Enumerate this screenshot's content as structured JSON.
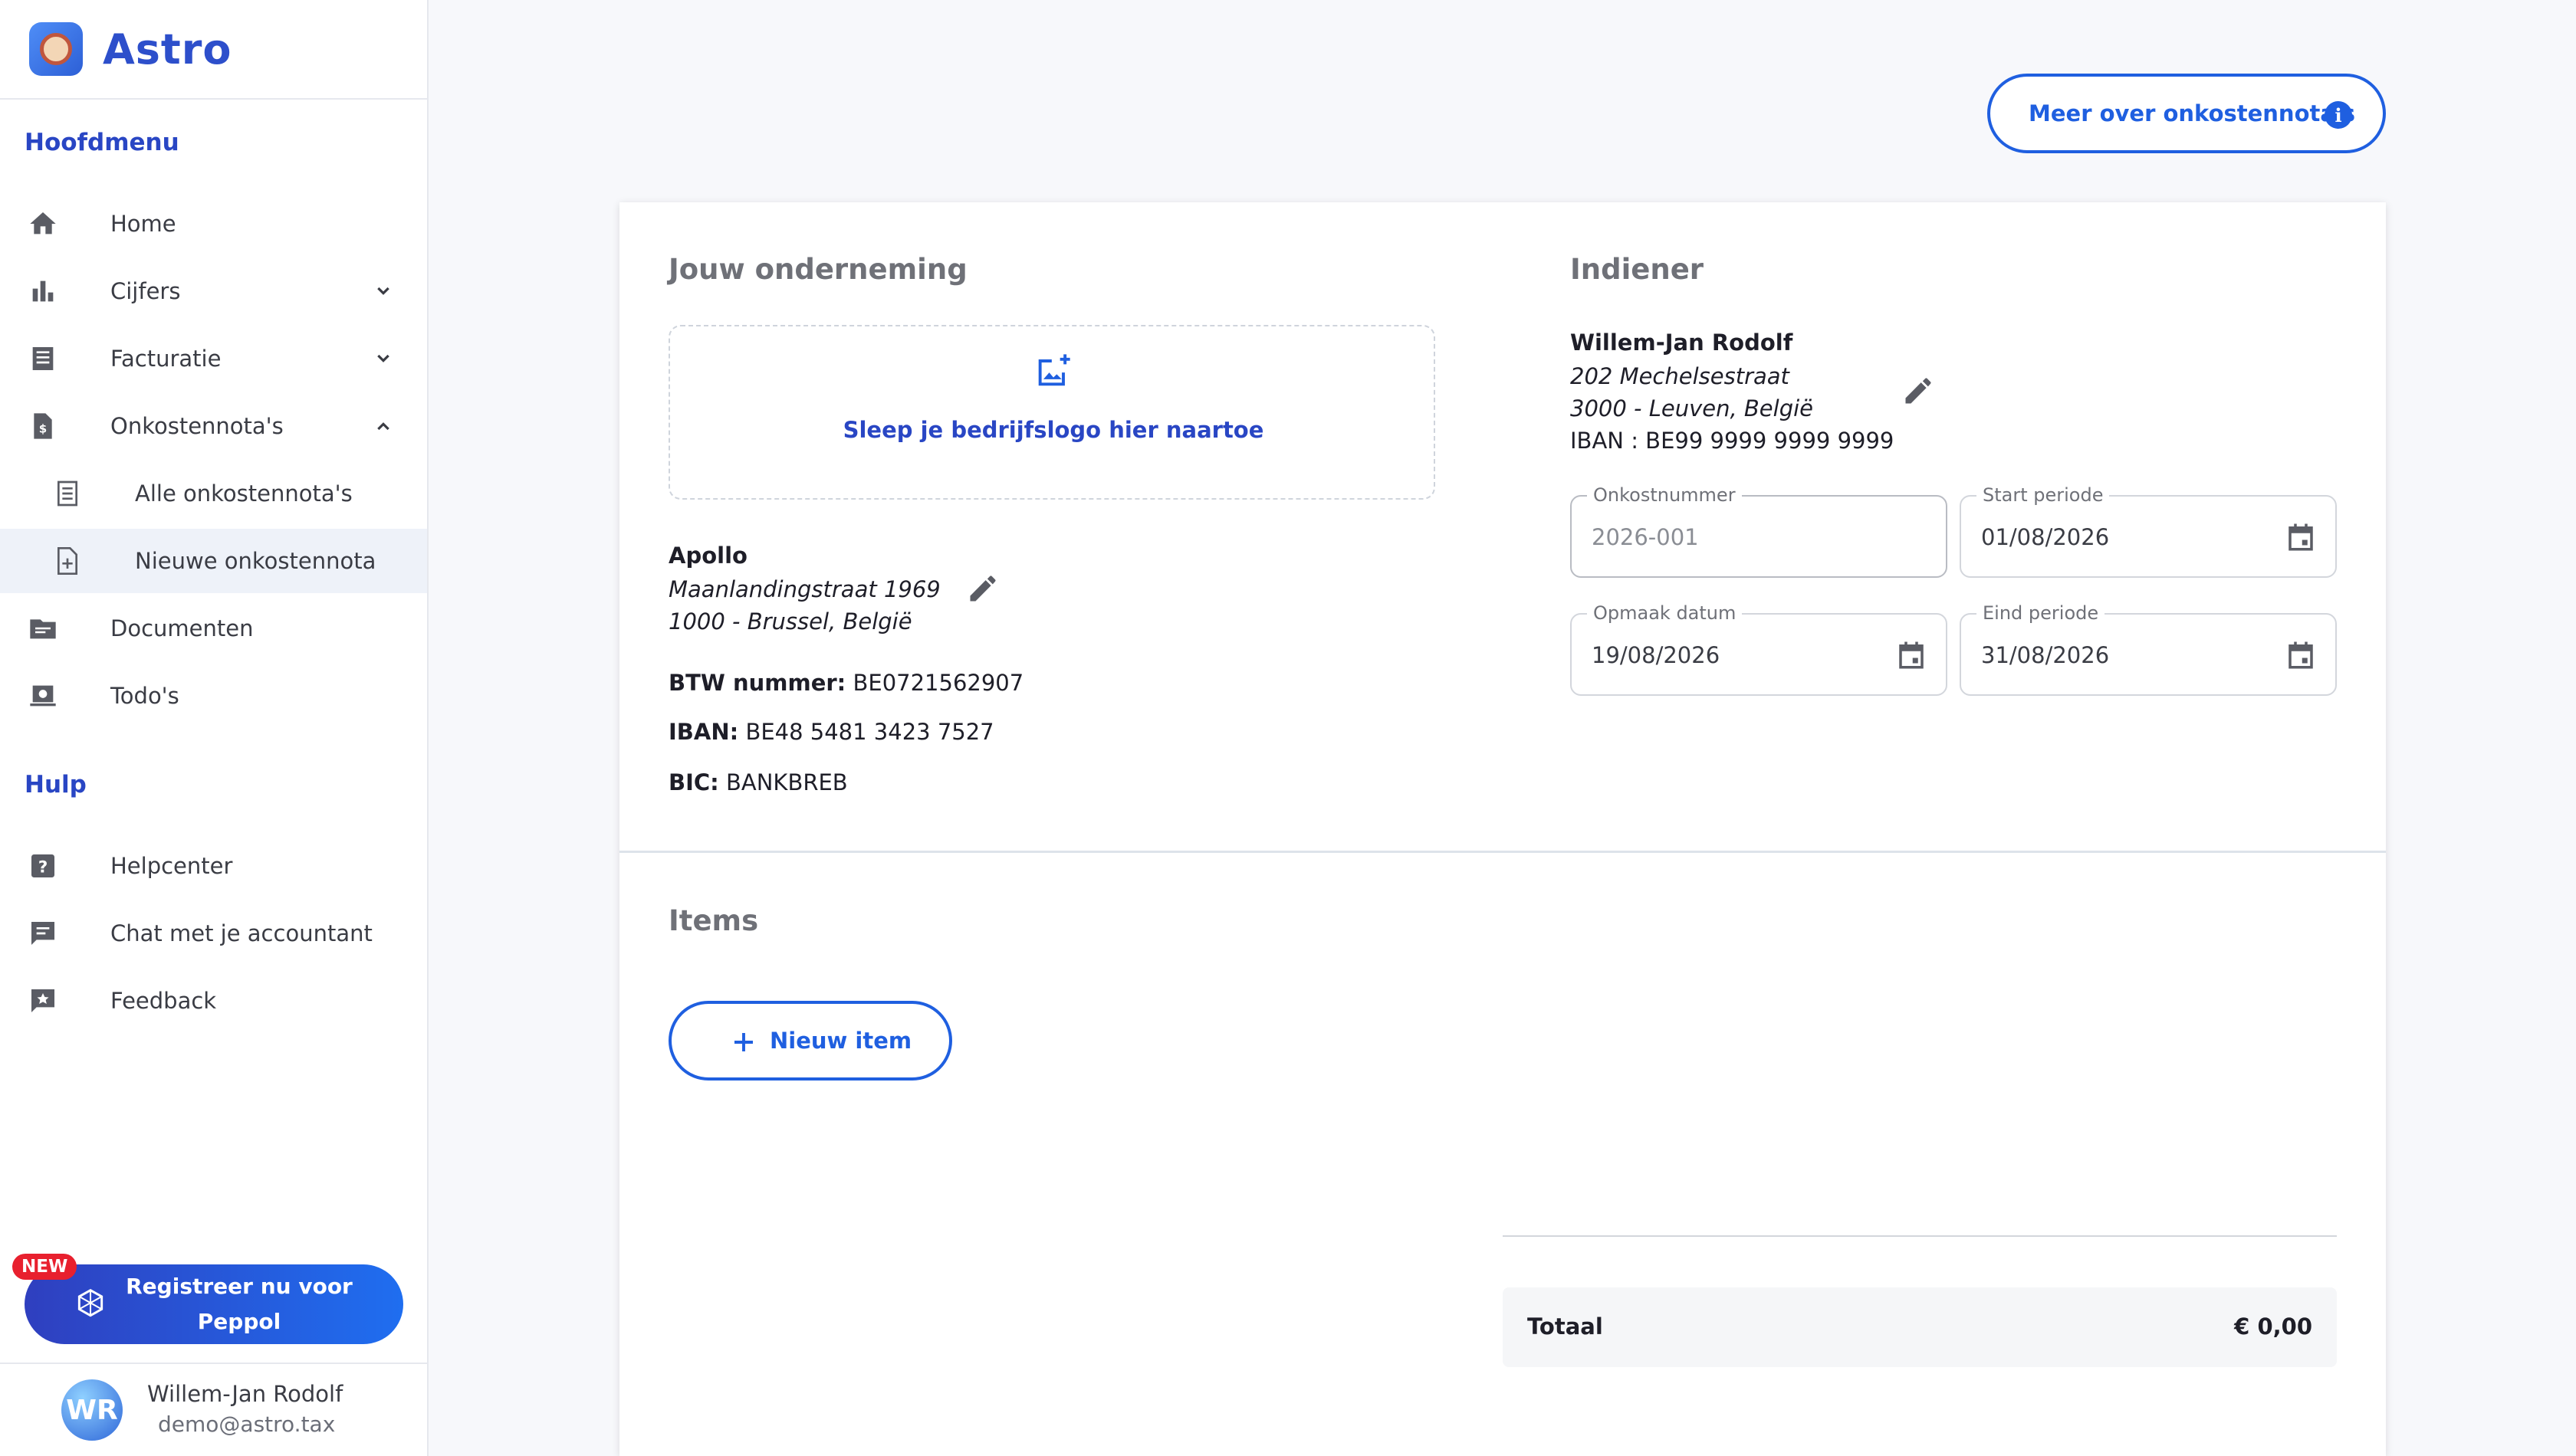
{
  "brand": {
    "name": "Astro"
  },
  "sidebar": {
    "main_title": "Hoofdmenu",
    "main_items": [
      {
        "label": "Home",
        "icon": "home-icon"
      },
      {
        "label": "Cijfers",
        "icon": "bar-chart-icon",
        "chevron": "down"
      },
      {
        "label": "Facturatie",
        "icon": "receipt-icon",
        "chevron": "down"
      },
      {
        "label": "Onkostennota's",
        "icon": "expense-document-icon",
        "chevron": "up"
      },
      {
        "label": "Alle onkostennota's",
        "icon": "list-document-icon"
      },
      {
        "label": "Nieuwe onkostennota",
        "icon": "add-document-icon",
        "active": true
      },
      {
        "label": "Documenten",
        "icon": "folder-icon"
      },
      {
        "label": "Todo's",
        "icon": "todo-icon"
      }
    ],
    "help_title": "Hulp",
    "help_items": [
      {
        "label": "Helpcenter",
        "icon": "help-icon"
      },
      {
        "label": "Chat met je accountant",
        "icon": "chat-icon"
      },
      {
        "label": "Feedback",
        "icon": "feedback-icon"
      }
    ],
    "peppol": {
      "badge": "NEW",
      "line1": "Registreer nu voor",
      "line2": "Peppol"
    },
    "user": {
      "initials": "WR",
      "name": "Willem-Jan Rodolf",
      "email": "demo@astro.tax"
    }
  },
  "header": {
    "info_button": "Meer over onkostennota's"
  },
  "company": {
    "title": "Jouw onderneming",
    "logo_drop": "Sleep je bedrijfslogo hier naartoe",
    "name": "Apollo",
    "street": "Maanlandingstraat 1969",
    "city": "1000 - Brussel, België",
    "vat_label": "BTW nummer:",
    "vat_value": "BE0721562907",
    "iban_label": "IBAN:",
    "iban_value": "BE48 5481 3423 7527",
    "bic_label": "BIC:",
    "bic_value": "BANKBREB"
  },
  "submitter": {
    "title": "Indiener",
    "name": "Willem-Jan Rodolf",
    "street": "202 Mechelsestraat",
    "city": "3000 - Leuven, België",
    "iban": "IBAN : BE99 9999 9999 9999"
  },
  "fields": {
    "number": {
      "label": "Onkostnummer",
      "value": "2026-001"
    },
    "start": {
      "label": "Start periode",
      "value": "01/08/2026"
    },
    "created": {
      "label": "Opmaak datum",
      "value": "19/08/2026"
    },
    "end": {
      "label": "Eind periode",
      "value": "31/08/2026"
    }
  },
  "items": {
    "title": "Items",
    "new_button": "Nieuw item"
  },
  "total": {
    "label": "Totaal",
    "value": "€ 0,00"
  },
  "colors": {
    "accent": "#1f5fe0",
    "brand": "#2946c4",
    "badge": "#e8202e"
  }
}
